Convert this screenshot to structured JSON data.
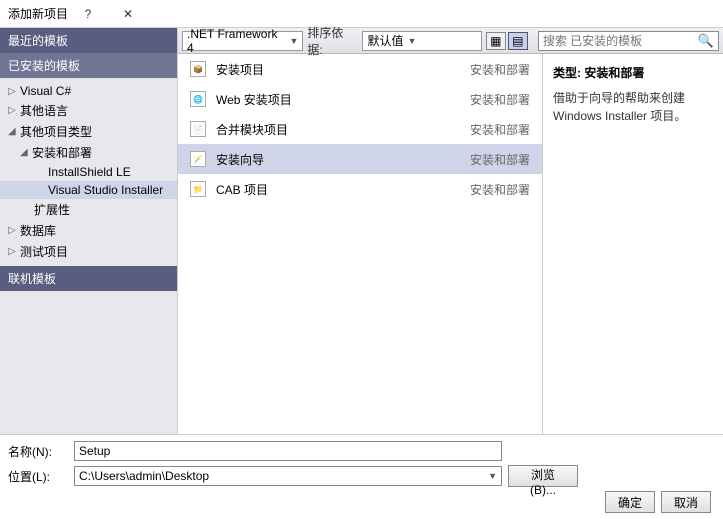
{
  "title": "添加新项目",
  "sidebar": {
    "recent": "最近的模板",
    "installed": "已安装的模板",
    "online": "联机模板",
    "tree": {
      "vcsharp": "Visual C#",
      "otherlang": "其他语言",
      "otherproj": "其他项目类型",
      "setupdeploy": "安装和部署",
      "installshield": "InstallShield LE",
      "vsinstaller": "Visual Studio Installer",
      "extensibility": "扩展性",
      "database": "数据库",
      "testproj": "测试项目"
    }
  },
  "toolbar": {
    "framework": ".NET Framework 4",
    "sort_label": "排序依据:",
    "sort_value": "默认值",
    "search_placeholder": "搜索 已安装的模板"
  },
  "list": {
    "items": [
      {
        "label": "安装项目",
        "category": "安装和部署"
      },
      {
        "label": "Web 安装项目",
        "category": "安装和部署"
      },
      {
        "label": "合并模块项目",
        "category": "安装和部署"
      },
      {
        "label": "安装向导",
        "category": "安装和部署"
      },
      {
        "label": "CAB 项目",
        "category": "安装和部署"
      }
    ]
  },
  "details": {
    "type_label": "类型:",
    "type_value": "安装和部署",
    "description": "借助于向导的帮助来创建 Windows Installer 项目。"
  },
  "bottom": {
    "name_label": "名称(N):",
    "name_value": "Setup",
    "location_label": "位置(L):",
    "location_value": "C:\\Users\\admin\\Desktop",
    "browse": "浏览(B)...",
    "ok": "确定",
    "cancel": "取消"
  }
}
